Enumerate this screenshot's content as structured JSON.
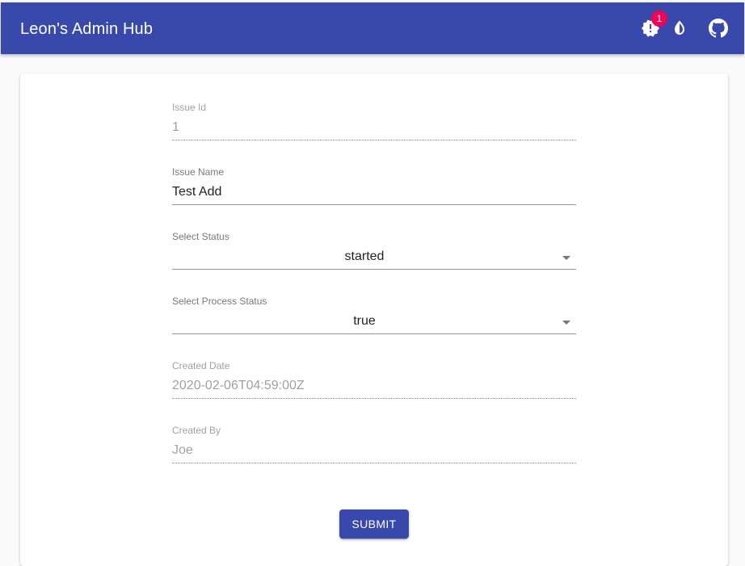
{
  "app": {
    "title": "Leon's Admin Hub",
    "notification_count": "1",
    "colors": {
      "primary": "#3949ab",
      "badge": "#f50057"
    },
    "icons": [
      "notification-alert-icon",
      "theme-toggle-icon",
      "github-icon"
    ]
  },
  "form": {
    "issue_id": {
      "label": "Issue Id",
      "value": "1"
    },
    "issue_name": {
      "label": "Issue Name",
      "value": "Test Add"
    },
    "status": {
      "label": "Select Status",
      "value": "started"
    },
    "process_status": {
      "label": "Select Process Status",
      "value": "true"
    },
    "created_date": {
      "label": "Created Date",
      "value": "2020-02-06T04:59:00Z"
    },
    "created_by": {
      "label": "Created By",
      "value": "Joe"
    },
    "submit_label": "SUBMIT"
  }
}
